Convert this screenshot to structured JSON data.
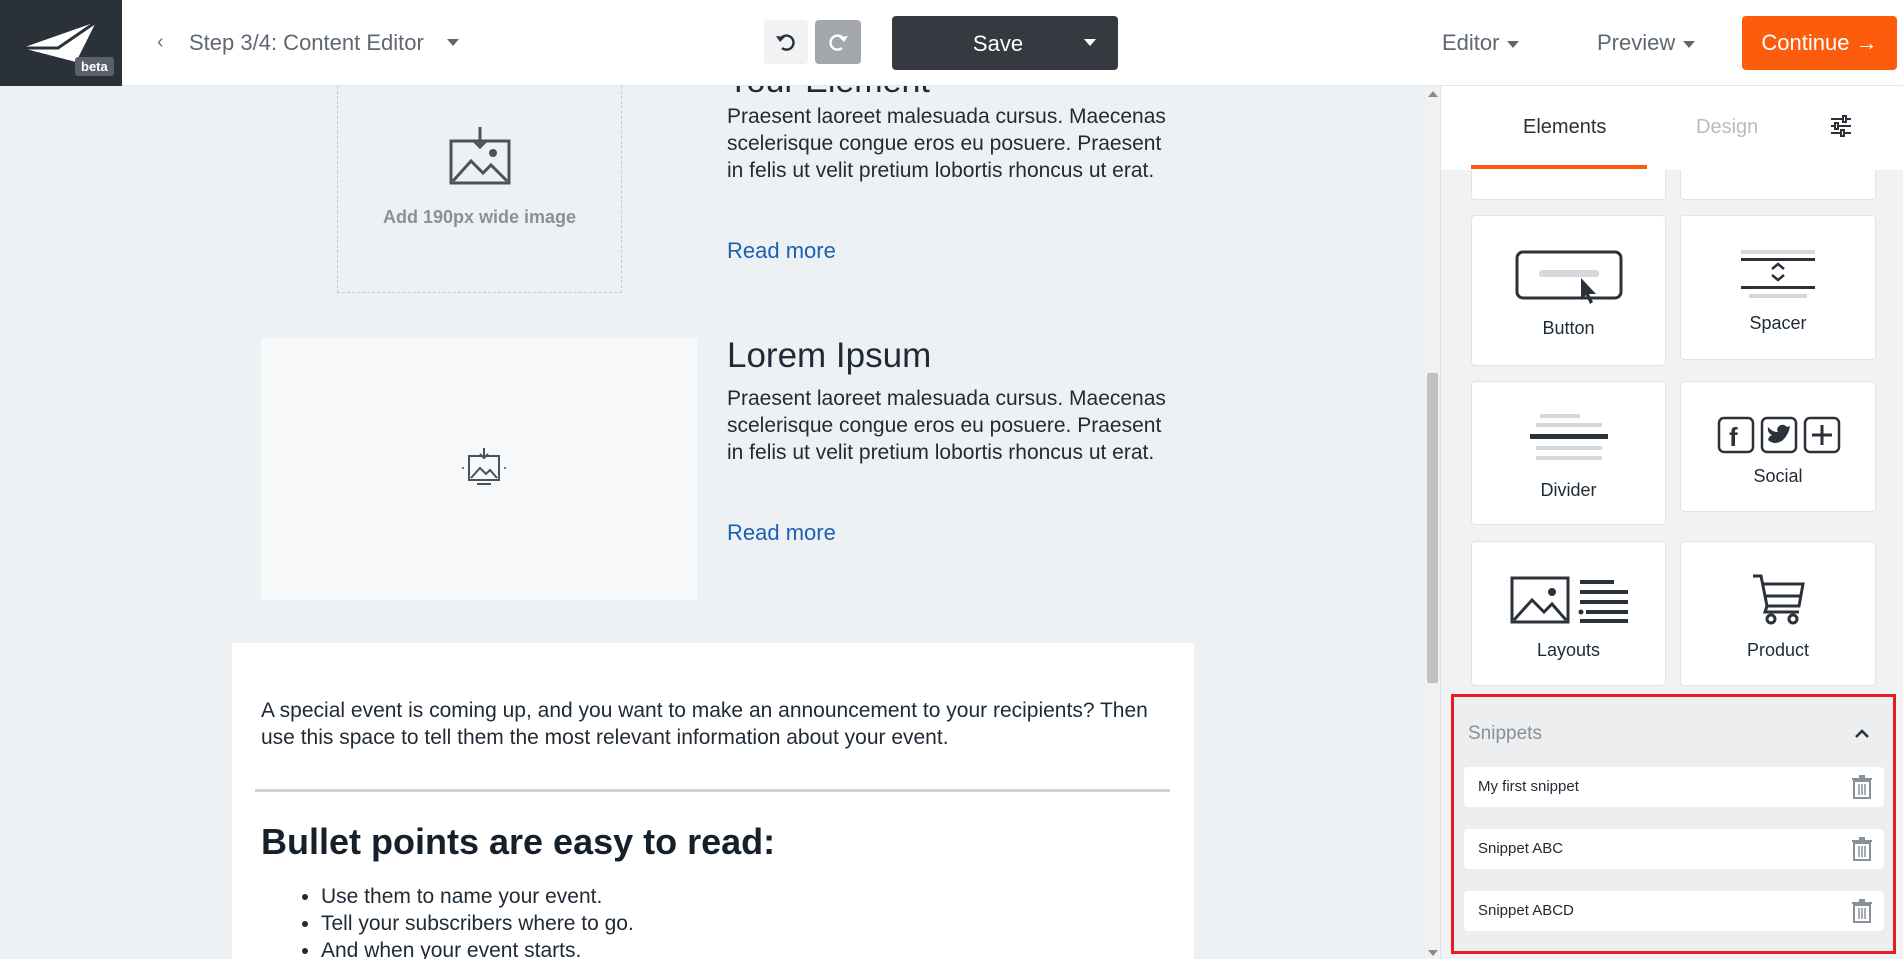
{
  "topbar": {
    "logo_badge": "beta",
    "back_chevron": "‹",
    "step_title": "Step 3/4: Content Editor",
    "save_label": "Save",
    "editor_label": "Editor",
    "preview_label": "Preview",
    "continue_label": "Continue →"
  },
  "canvas": {
    "article1": {
      "title_cut": "Your Element",
      "image_placeholder": "Add 190px wide image",
      "body": "Praesent laoreet malesuada cursus. Maecenas scelerisque congue eros eu posuere. Praesent in felis ut velit pretium lobortis rhoncus ut erat.",
      "read_more": "Read more"
    },
    "article2": {
      "title": "Lorem Ipsum",
      "body": "Praesent laoreet malesuada cursus. Maecenas scelerisque congue eros eu posuere. Praesent in felis ut velit pretium lobortis rhoncus ut erat.",
      "read_more": "Read more"
    },
    "announcement": "A special event is coming up, and you want to make an announcement to your recipients? Then use this space to tell them the most relevant information about your event.",
    "bullets_title": "Bullet points are easy to read:",
    "bullets": [
      "Use them to name your event.",
      "Tell your subscribers where to go.",
      "And when your event starts."
    ]
  },
  "panel": {
    "tabs": {
      "elements": "Elements",
      "design": "Design"
    },
    "tiles": {
      "button": "Button",
      "spacer": "Spacer",
      "divider": "Divider",
      "social": "Social",
      "layouts": "Layouts",
      "product": "Product"
    },
    "snippets": {
      "header": "Snippets",
      "items": [
        "My first snippet",
        "Snippet ABC",
        "Snippet ABCD"
      ]
    }
  },
  "colors": {
    "accent": "#fd5c0c",
    "dark": "#343a40",
    "link": "#1a60b5",
    "highlight": "#e02020"
  }
}
